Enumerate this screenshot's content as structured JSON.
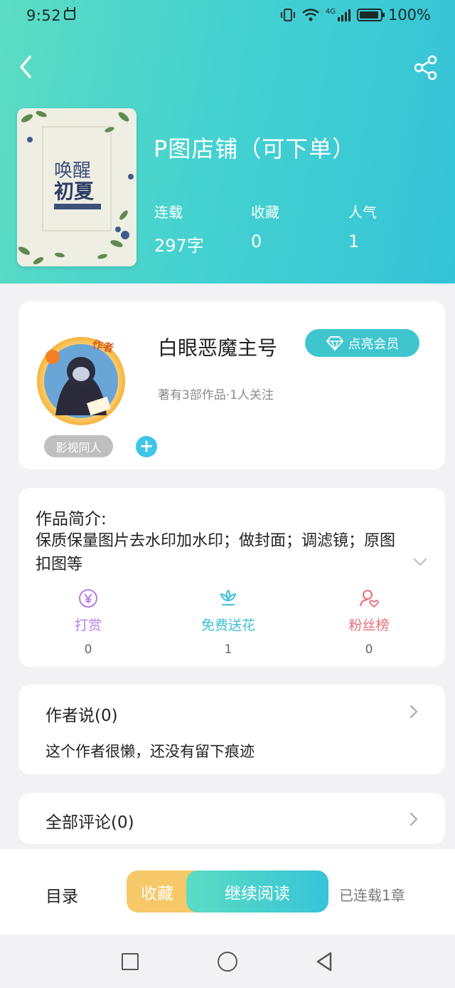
{
  "status_bar": {
    "time": "9:52",
    "battery": "100%",
    "network": "4G"
  },
  "header": {
    "book_title": "P图店铺（可下单）",
    "cover": {
      "title_top": "唤醒",
      "title_bottom": "初夏"
    },
    "stats": [
      {
        "label": "连载",
        "value": "297字"
      },
      {
        "label": "收藏",
        "value": "0"
      },
      {
        "label": "人气",
        "value": "1"
      }
    ]
  },
  "author": {
    "name": "白眼恶魔主号",
    "badge": "作者",
    "vip_label": "点亮会员",
    "meta": "著有3部作品·1人关注",
    "tag": "影视同人",
    "add_tag": "+"
  },
  "intro": {
    "title": "作品简介:",
    "text": "保质保量图片去水印加水印；做封面；调滤镜；原图扣图等",
    "actions": [
      {
        "icon": "yen-coin-icon",
        "label": "打赏",
        "count": "0",
        "color": "#b27ee0"
      },
      {
        "icon": "flower-icon",
        "label": "免费送花",
        "count": "1",
        "color": "#3ec0d6"
      },
      {
        "icon": "fan-user-heart-icon",
        "label": "粉丝榜",
        "count": "0",
        "color": "#ea6e78"
      }
    ]
  },
  "author_says": {
    "title": "作者说(0)",
    "text": "这个作者很懒，还没有留下痕迹"
  },
  "comments": {
    "title": "全部评论(0)"
  },
  "bottom_bar": {
    "toc_label": "目录",
    "favorite_label": "收藏",
    "continue_label": "继续阅读",
    "serial_note": "已连载1章"
  },
  "colors": {
    "accent": "#3ec5ce",
    "favorite": "#f6c867",
    "gradient_start": "#5cdcc3",
    "gradient_end": "#35c3d8"
  }
}
